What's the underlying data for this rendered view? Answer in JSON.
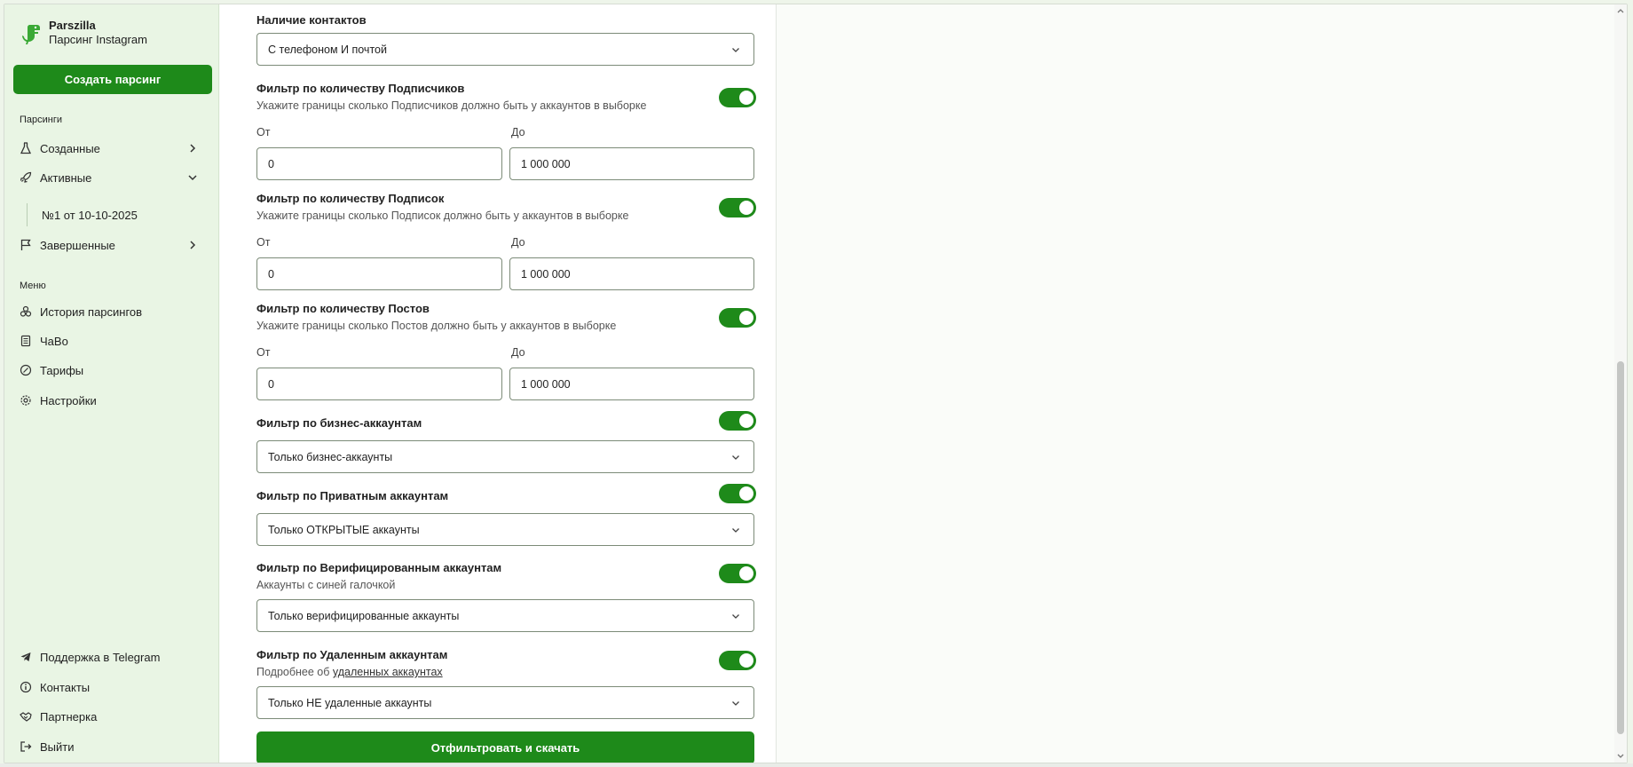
{
  "brand": {
    "name": "Parszilla",
    "subtitle": "Парсинг Instagram"
  },
  "sidebar": {
    "create_button": "Создать парсинг",
    "section_parsings": "Парсинги",
    "parsings": [
      {
        "label": "Созданные",
        "icon": "flask-icon",
        "chevron": "right"
      },
      {
        "label": "Активные",
        "icon": "rocket-icon",
        "chevron": "down"
      },
      {
        "label": "Завершенные",
        "icon": "flag-icon",
        "chevron": "right"
      }
    ],
    "active_sub_item": "№1 от 10-10-2025",
    "section_menu": "Меню",
    "menu": [
      {
        "label": "История парсингов",
        "icon": "history-icon"
      },
      {
        "label": "ЧаВо",
        "icon": "faq-icon"
      },
      {
        "label": "Тарифы",
        "icon": "tariffs-icon"
      },
      {
        "label": "Настройки",
        "icon": "gear-icon"
      }
    ],
    "bottom": [
      {
        "label": "Поддержка в Telegram",
        "icon": "telegram-icon"
      },
      {
        "label": "Контакты",
        "icon": "info-icon"
      },
      {
        "label": "Партнерка",
        "icon": "handshake-icon"
      },
      {
        "label": "Выйти",
        "icon": "logout-icon"
      }
    ]
  },
  "form": {
    "contacts": {
      "label": "Наличие контактов",
      "value": "С телефоном И почтой"
    },
    "followers": {
      "label": "Фильтр по количеству Подписчиков",
      "hint": "Укажите границы сколько Подписчиков должно быть у аккаунтов в выборке",
      "enabled": true,
      "from_label": "От",
      "to_label": "До",
      "from": "0",
      "to": "1 000 000"
    },
    "following": {
      "label": "Фильтр по количеству Подписок",
      "hint": "Укажите границы сколько Подписок должно быть у аккаунтов в выборке",
      "enabled": true,
      "from_label": "От",
      "to_label": "До",
      "from": "0",
      "to": "1 000 000"
    },
    "posts": {
      "label": "Фильтр по количеству Постов",
      "hint": "Укажите границы сколько Постов должно быть у аккаунтов в выборке",
      "enabled": true,
      "from_label": "От",
      "to_label": "До",
      "from": "0",
      "to": "1 000 000"
    },
    "business": {
      "label": "Фильтр по бизнес-аккаунтам",
      "enabled": true,
      "value": "Только бизнес-аккаунты"
    },
    "private": {
      "label": "Фильтр по Приватным аккаунтам",
      "enabled": true,
      "value": "Только ОТКРЫТЫЕ аккаунты"
    },
    "verified": {
      "label": "Фильтр по Верифицированным аккаунтам",
      "hint": "Аккаунты с синей галочкой",
      "enabled": true,
      "value": "Только верифицированные аккаунты"
    },
    "deleted": {
      "label": "Фильтр по Удаленным аккаунтам",
      "hint_prefix": "Подробнее об ",
      "hint_link": "удаленных аккаунтах",
      "enabled": true,
      "value": "Только НЕ удаленные аккаунты"
    },
    "submit": "Отфильтровать и скачать"
  },
  "colors": {
    "accent": "#1e8a1a",
    "sidebar_bg": "#e9f5e4"
  }
}
